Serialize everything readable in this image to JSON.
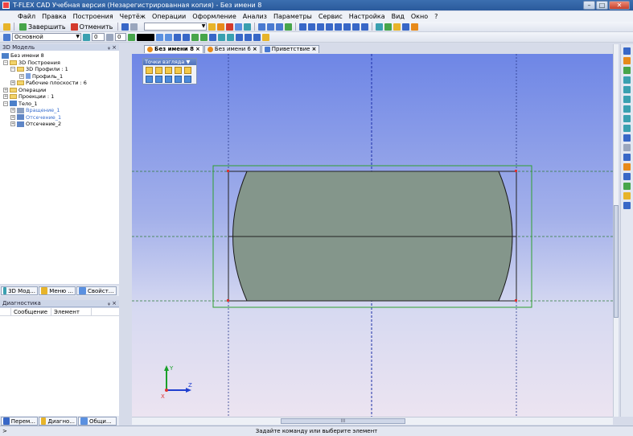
{
  "window": {
    "title": "T-FLEX CAD Учебная версия (Незарегистрированная копия) - Без имени 8",
    "controls": [
      "minimize",
      "maximize",
      "close"
    ]
  },
  "menu": [
    "Файл",
    "Правка",
    "Построения",
    "Чертёж",
    "Операции",
    "Оформление",
    "Анализ",
    "Параметры",
    "Сервис",
    "Настройка",
    "Вид",
    "Окно",
    "?"
  ],
  "toolbar1": {
    "finish_label": "Завершить",
    "cancel_label": "Отменить"
  },
  "toolbar2": {
    "layer_combo": "Основной",
    "level_combo": "0",
    "priority_combo": "0",
    "color": "#000000"
  },
  "left_panel": {
    "title": "3D Модель",
    "pin": "ᵩ ×",
    "tree": [
      {
        "label": "Без имени 8",
        "level": 0,
        "icon": "model-icon",
        "expand": ""
      },
      {
        "label": "3D Построения",
        "level": 1,
        "icon": "folder-icon",
        "expand": "−"
      },
      {
        "label": "3D Профили : 1",
        "level": 2,
        "icon": "folder-icon",
        "expand": "−"
      },
      {
        "label": "Профиль_1",
        "level": 3,
        "icon": "profile-icon",
        "expand": "+"
      },
      {
        "label": "Рабочие плоскости : 6",
        "level": 2,
        "icon": "folder-icon",
        "expand": "+"
      },
      {
        "label": "Операции",
        "level": 0,
        "icon": "folder-icon",
        "expand": "+"
      },
      {
        "label": "Проекции : 1",
        "level": 0,
        "icon": "folder-icon",
        "expand": "+"
      },
      {
        "label": "Тело_1",
        "level": 0,
        "icon": "body-icon",
        "expand": "−"
      },
      {
        "label": "Вращение_1",
        "level": 1,
        "icon": "rotation-icon",
        "expand": "+",
        "blue": true
      },
      {
        "label": "Отсечение_1",
        "level": 1,
        "icon": "cut-icon",
        "expand": "+",
        "blue": true
      },
      {
        "label": "Отсечение_2",
        "level": 1,
        "icon": "cut-icon",
        "expand": "+"
      }
    ],
    "tabs": [
      "3D Мод...",
      "Меню ...",
      "Свойст..."
    ]
  },
  "diagnostics_panel": {
    "title": "Диагностика",
    "pin": "ᵩ ×",
    "columns": [
      "Сообщение",
      "Элемент"
    ],
    "tabs": [
      "Перем...",
      "Диагно...",
      "Общи..."
    ]
  },
  "doc_tabs": [
    {
      "label": "Без имени 8",
      "active": true
    },
    {
      "label": "Без имени 6",
      "active": false
    },
    {
      "label": "Приветствие",
      "active": false
    }
  ],
  "viewpoints_toolbar": {
    "title": "Точки взгляда ▼ ×"
  },
  "model": {
    "fill_color": "#84968b",
    "frame_color": "#2fa02f",
    "axis_color": "#1c2fa8",
    "axes": [
      "Y",
      "Z",
      "X"
    ]
  },
  "hscroll_label": "III",
  "status": {
    "prompt": ">",
    "message": "Задайте команду или выберите элемент"
  }
}
